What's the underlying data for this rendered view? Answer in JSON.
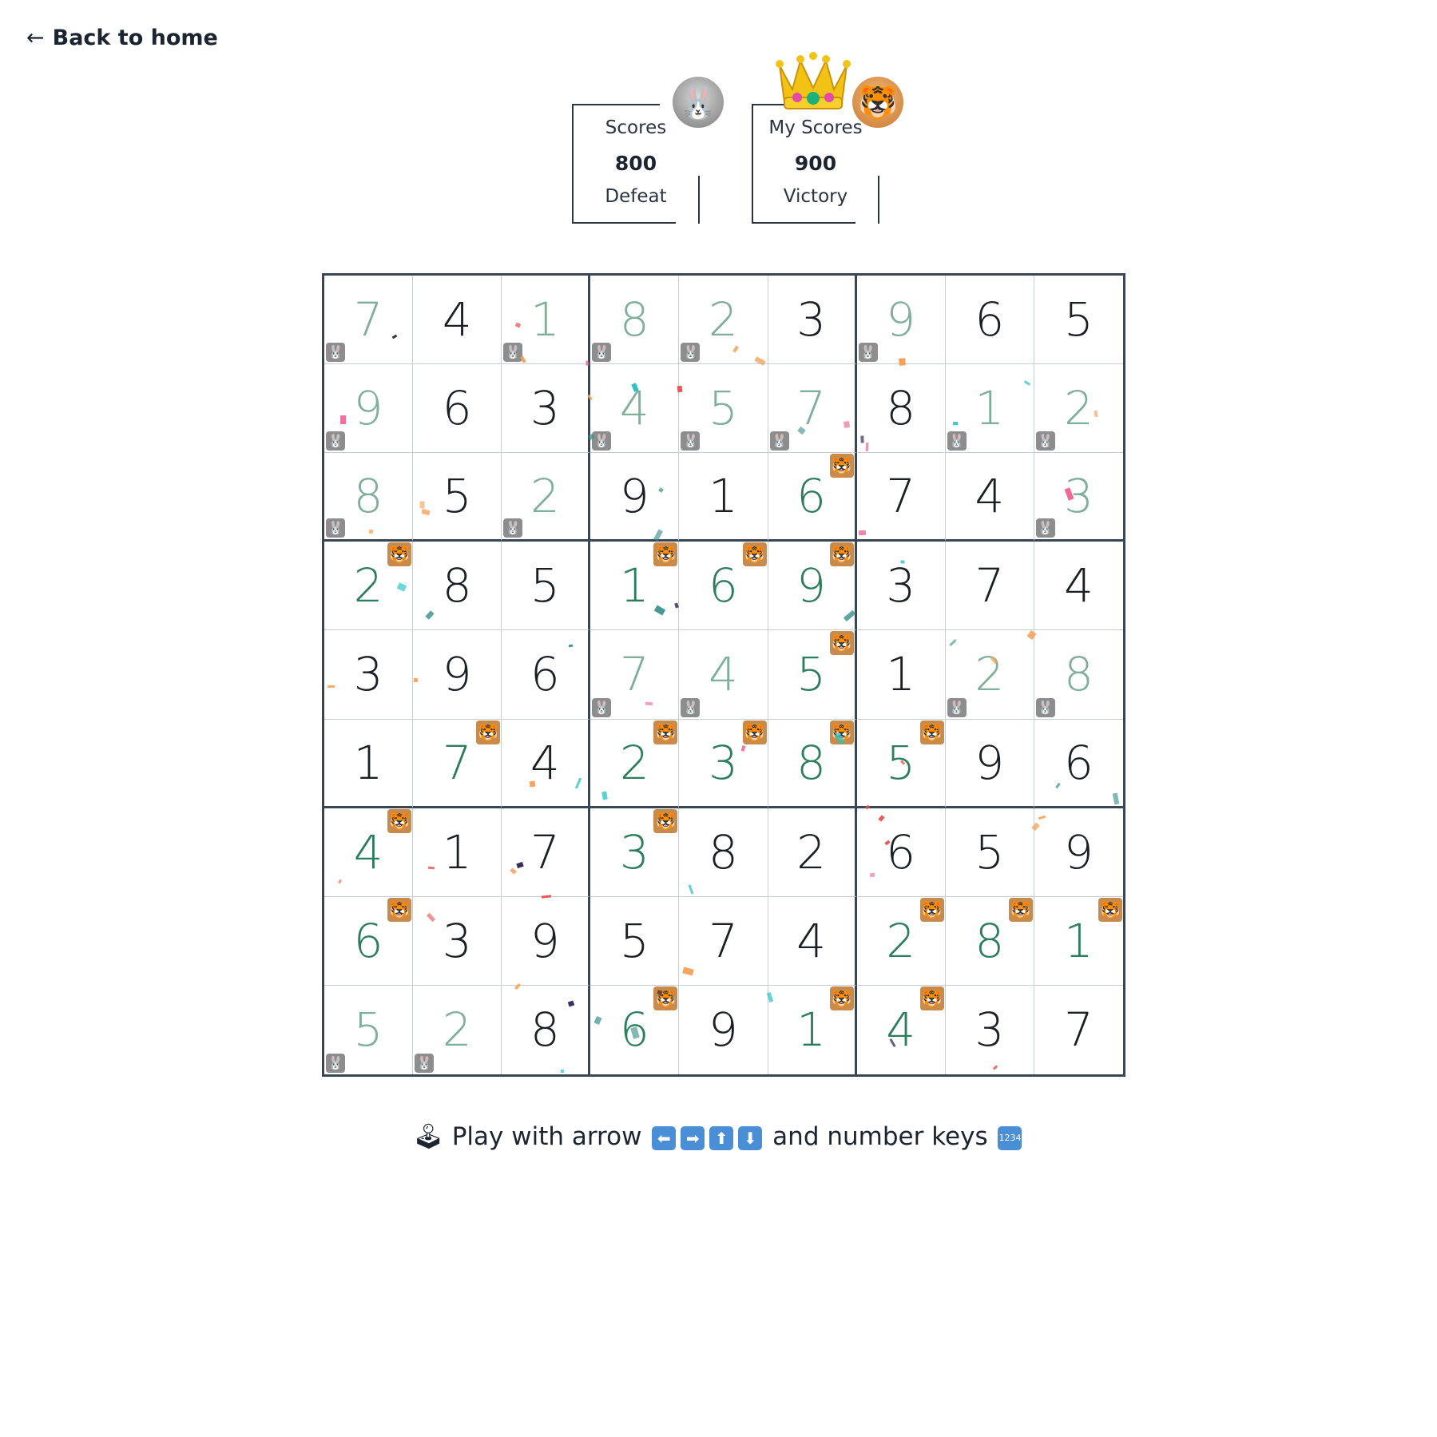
{
  "nav": {
    "back_arrow": "←",
    "back_label": "Back to home"
  },
  "opponent": {
    "label": "Scores",
    "score": "800",
    "result": "Defeat",
    "avatar_icon": "rabbit-icon"
  },
  "me": {
    "label": "My Scores",
    "score": "900",
    "result": "Victory",
    "avatar_icon": "tiger-icon",
    "winner_icon": "crown-icon"
  },
  "board": {
    "rows": [
      [
        "7",
        "4",
        "1",
        "8",
        "2",
        "3",
        "9",
        "6",
        "5"
      ],
      [
        "9",
        "6",
        "3",
        "4",
        "5",
        "7",
        "8",
        "1",
        "2"
      ],
      [
        "8",
        "5",
        "2",
        "9",
        "1",
        "6",
        "7",
        "4",
        "3"
      ],
      [
        "2",
        "8",
        "5",
        "1",
        "6",
        "9",
        "3",
        "7",
        "4"
      ],
      [
        "3",
        "9",
        "6",
        "7",
        "4",
        "5",
        "1",
        "2",
        "8"
      ],
      [
        "1",
        "7",
        "4",
        "2",
        "3",
        "8",
        "5",
        "9",
        "6"
      ],
      [
        "4",
        "1",
        "7",
        "3",
        "8",
        "2",
        "6",
        "5",
        "9"
      ],
      [
        "6",
        "3",
        "9",
        "5",
        "7",
        "4",
        "2",
        "8",
        "1"
      ],
      [
        "5",
        "2",
        "8",
        "6",
        "9",
        "1",
        "4",
        "3",
        "7"
      ]
    ],
    "owners": [
      [
        "opp",
        "given",
        "opp",
        "opp",
        "opp",
        "given",
        "opp",
        "given",
        "given"
      ],
      [
        "opp",
        "given",
        "given",
        "opp",
        "opp",
        "opp",
        "given",
        "opp",
        "opp"
      ],
      [
        "opp",
        "given",
        "opp",
        "given",
        "given",
        "me",
        "given",
        "given",
        "opp"
      ],
      [
        "me",
        "given",
        "given",
        "me",
        "me",
        "me",
        "given",
        "given",
        "given"
      ],
      [
        "given",
        "given",
        "given",
        "opp",
        "opp",
        "me",
        "given",
        "opp",
        "opp"
      ],
      [
        "given",
        "me",
        "given",
        "me",
        "me",
        "me",
        "me",
        "given",
        "given"
      ],
      [
        "me",
        "given",
        "given",
        "me",
        "given",
        "given",
        "given",
        "given",
        "given"
      ],
      [
        "me",
        "given",
        "given",
        "given",
        "given",
        "given",
        "me",
        "me",
        "me"
      ],
      [
        "opp",
        "opp",
        "given",
        "me",
        "given",
        "me",
        "me",
        "given",
        "given"
      ]
    ]
  },
  "hint": {
    "prefix_icon": "joystick-icon",
    "text_1": "Play with arrow",
    "keys": [
      "⬅",
      "➡",
      "⬆",
      "⬇"
    ],
    "text_2": "and number keys",
    "suffix_icon": "numbers-keycap-icon",
    "suffix_glyph": "1234"
  },
  "colors": {
    "given": "#1b1f24",
    "opponent_digit": "#7fae9b",
    "my_digit": "#2b7d5c",
    "grid": "#3a4656"
  }
}
